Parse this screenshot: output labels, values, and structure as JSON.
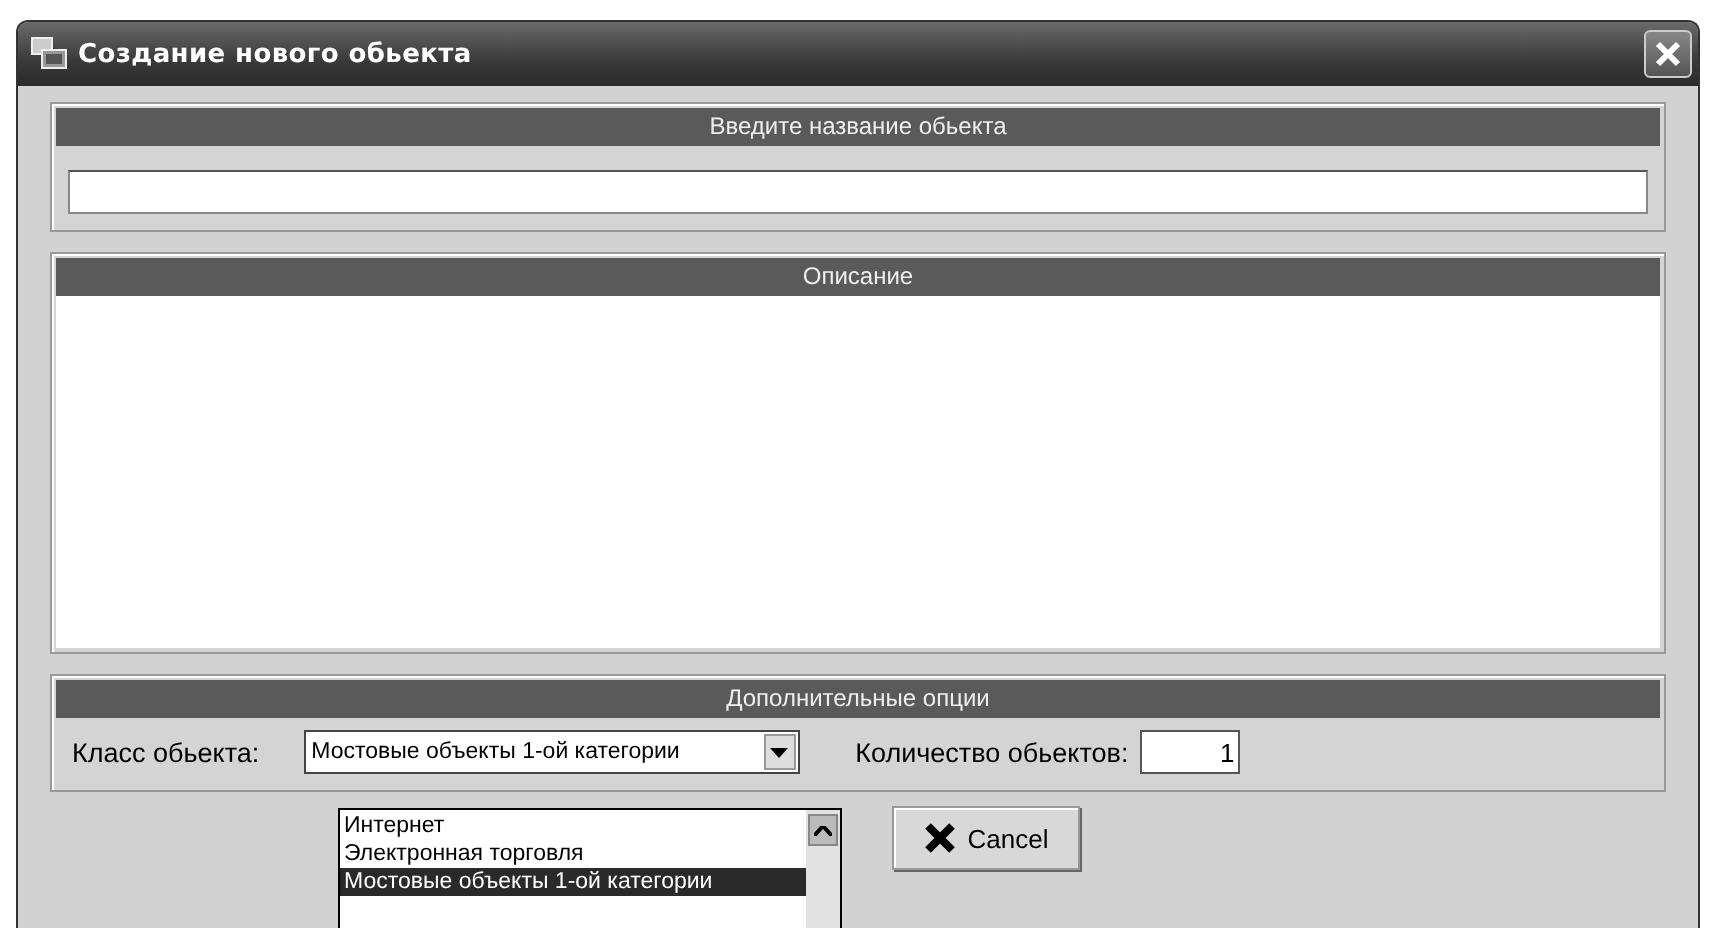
{
  "window": {
    "title": "Создание нового обьекта"
  },
  "name_section": {
    "header": "Введите название обьекта",
    "field": {
      "kind": "text"
    }
  },
  "description_section": {
    "header": "Описание"
  },
  "options_section": {
    "header": "Дополнительные опции",
    "class_label": "Класс обьекта:",
    "class_value": "Мостовые объекты 1-ой категории",
    "count_label": "Количество обьектов:",
    "count_value": "1"
  },
  "dropdown": {
    "items": [
      {
        "label": "Интернет",
        "selected": false
      },
      {
        "label": "Электронная торговля",
        "selected": false
      },
      {
        "label": "Мостовые объекты 1-ой категории",
        "selected": true
      }
    ]
  },
  "buttons": [
    {
      "label": "Cancel",
      "kind": "cancel"
    }
  ]
}
